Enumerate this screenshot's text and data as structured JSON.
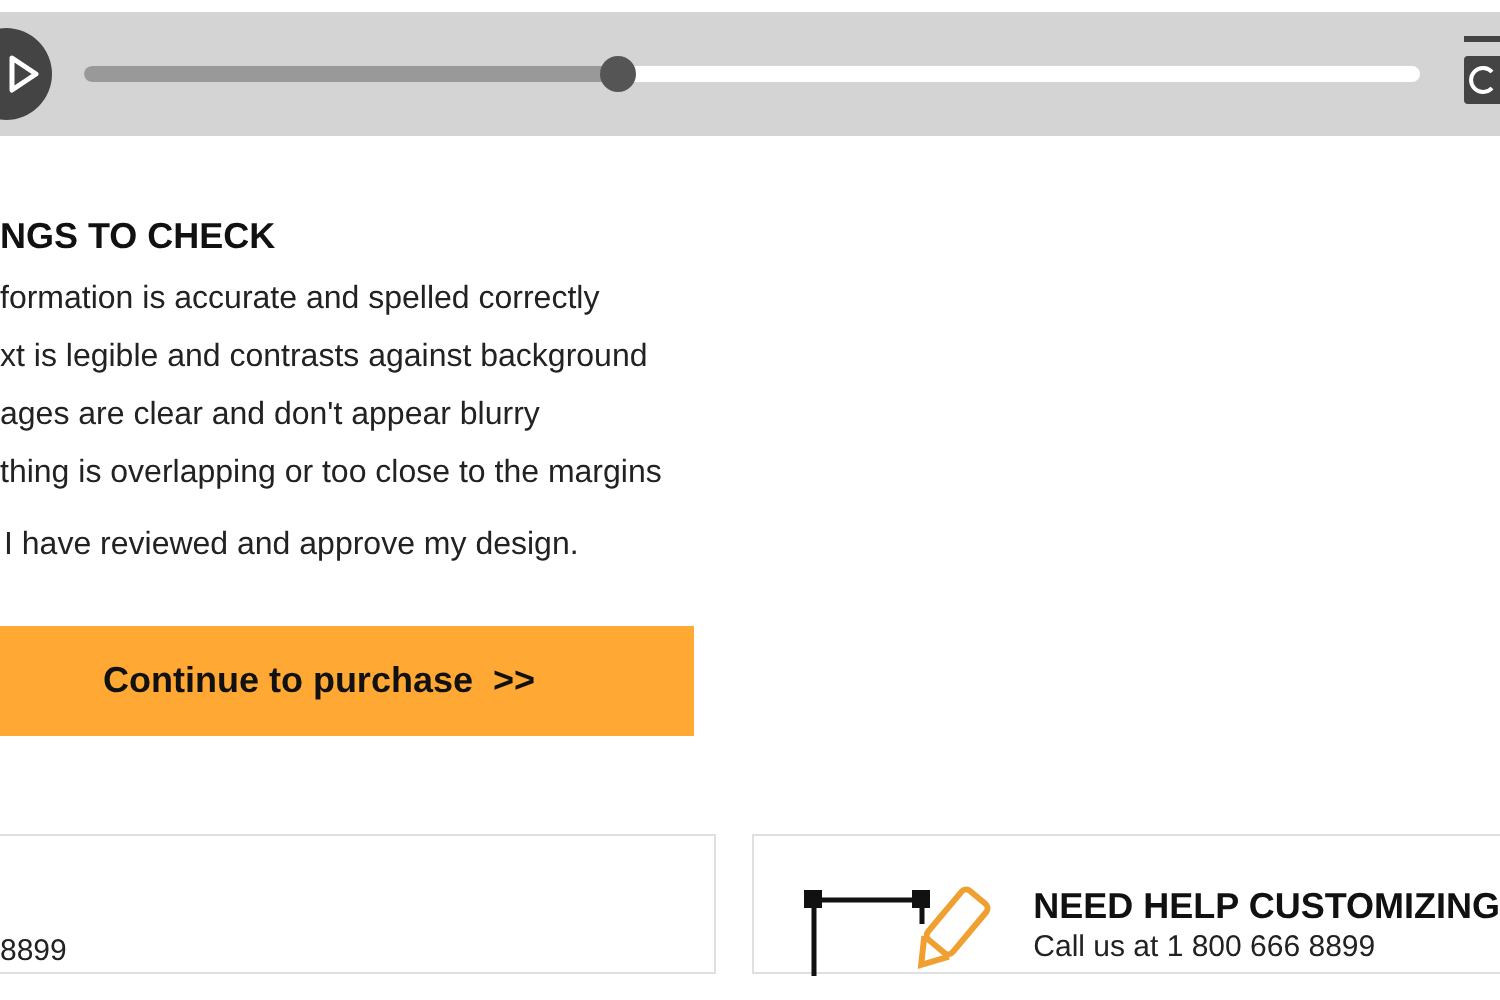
{
  "player": {
    "playing": false,
    "level": 0.4
  },
  "checklist": {
    "heading": "NGS TO CHECK",
    "items": [
      "formation is accurate and spelled correctly",
      "xt is legible and contrasts against background",
      "ages are clear and don't appear blurry",
      "thing is overlapping or too close to the margins"
    ],
    "approval": "I have reviewed and approve my design."
  },
  "purchase_button": "Continue to purchase  >>",
  "cards": [
    {
      "kind": "phone",
      "text": "8899"
    },
    {
      "kind": "help",
      "title": "NEED HELP CUSTOMIZING",
      "text": "Call us at 1 800 666 8899"
    }
  ]
}
